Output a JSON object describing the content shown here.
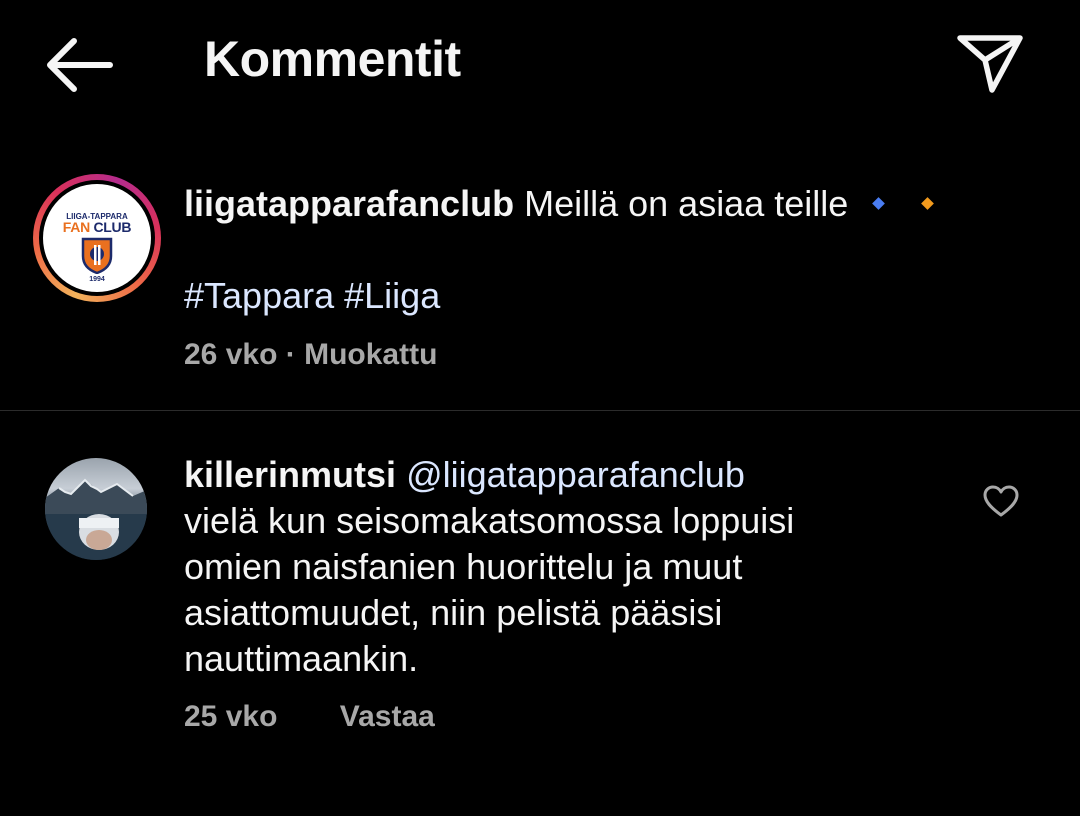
{
  "header": {
    "title": "Kommentit",
    "back_icon": "arrow-left-icon",
    "share_icon": "paper-plane-icon"
  },
  "caption": {
    "avatar_text_top": "LIIGA-TAPPARA",
    "avatar_text_fan": "FAN",
    "avatar_text_club": "CLUB",
    "avatar_year": "1994",
    "username": "liigatapparafanclub",
    "text": "Meillä on asiaa teille",
    "emoji_1": "small-blue-diamond",
    "emoji_2": "small-orange-diamond",
    "hashtags": [
      "#Tappara",
      "#Liiga"
    ],
    "time": "26 vko",
    "separator": "·",
    "edited": "Muokattu"
  },
  "comment": {
    "username": "killerinmutsi",
    "mention": "@liigatapparafanclub",
    "lines": [
      "vielä kun seisomakatsomossa loppuisi",
      "omien naisfanien huorittelu ja muut",
      "asiattomuudet, niin pelistä pääsisi",
      "nauttimaankin."
    ],
    "time": "25 vko",
    "reply_label": "Vastaa",
    "like_icon": "heart-outline-icon"
  },
  "colors": {
    "background": "#000000",
    "text": "#f5f5f5",
    "muted": "#a8a8a8",
    "link": "#dbe7ff",
    "diamond_blue": "#4a7df2",
    "diamond_orange": "#f29a1d"
  }
}
